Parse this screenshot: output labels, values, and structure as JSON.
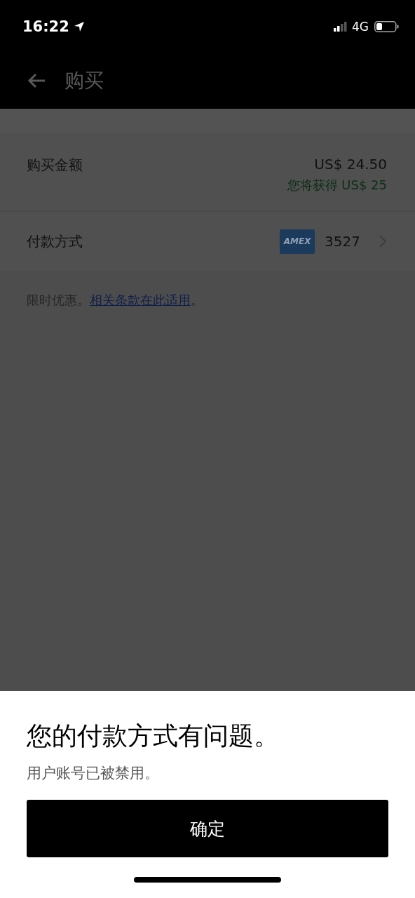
{
  "status_bar": {
    "time": "16:22",
    "network": "4G"
  },
  "header": {
    "title": "购买"
  },
  "rows": [
    {
      "kind": "amount",
      "label": "购买金额",
      "value": "US$ 24.50",
      "note": "您将获得 US$ 25"
    },
    {
      "kind": "payment",
      "label": "付款方式",
      "card_brand": "AMEX",
      "card_number": "3527"
    }
  ],
  "terms": {
    "text": "限时优惠。",
    "link": "相关条款在此适用",
    "end": "。"
  },
  "sheet": {
    "title": "您的付款方式有问题。",
    "message": "用户账号已被禁用。",
    "button": "确定"
  }
}
